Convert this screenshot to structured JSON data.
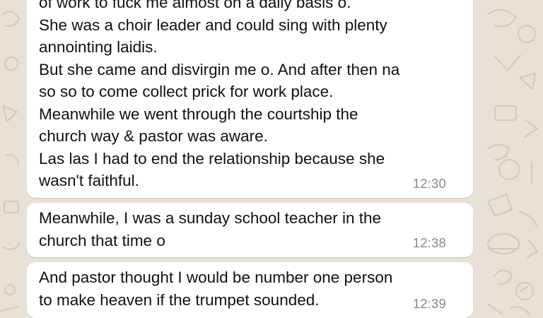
{
  "theme": {
    "wallpaper_color": "#e8e1d6",
    "bubble_color": "#ffffff",
    "text_color": "#111111",
    "time_color": "#8a8a8a"
  },
  "messages": [
    {
      "lines": [
        "of work to fuck me almost on a daily basis o.",
        "She was a choir leader and could sing with plenty",
        "annointing laidis.",
        "But she came and disvirgin me o. And after then na",
        "so so to come collect prick for work place.",
        "Meanwhile we went through the courtship the",
        "church way & pastor was aware.",
        "Las las I had to end the relationship because she",
        "wasn't faithful."
      ],
      "time": "12:30"
    },
    {
      "lines": [
        "Meanwhile, I was a sunday school teacher in the",
        "church that time o"
      ],
      "time": "12:38"
    },
    {
      "lines": [
        "And pastor thought I would be number one person",
        "to make heaven if the trumpet sounded."
      ],
      "time": "12:39"
    }
  ]
}
